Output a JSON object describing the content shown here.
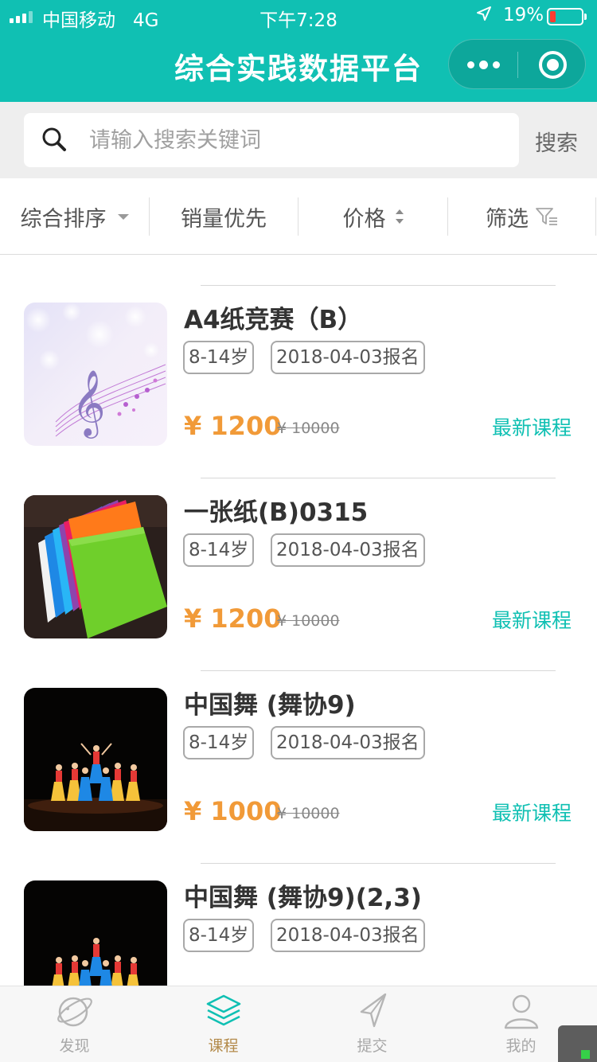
{
  "status_bar": {
    "carrier": "中国移动",
    "network": "4G",
    "time": "下午7:28",
    "battery_percent": "19%",
    "battery_level": 0.19
  },
  "nav": {
    "title": "综合实践数据平台",
    "more_icon": "more-dots-icon",
    "close_icon": "target-close-icon"
  },
  "search": {
    "placeholder": "请输入搜索关键词",
    "value": "",
    "button_label": "搜索"
  },
  "filters": [
    {
      "label": "综合排序",
      "icon": "caret-down-icon"
    },
    {
      "label": "销量优先"
    },
    {
      "label": "价格",
      "icon": "sort-updown-icon"
    },
    {
      "label": "筛选",
      "icon": "funnel-icon"
    }
  ],
  "courses": [
    {
      "title": "A4纸竞赛（B）",
      "age": "8-14岁",
      "enroll": "2018-04-03报名",
      "price": "¥ 1200",
      "original_price": "¥ 10000",
      "badge": "最新课程",
      "image": "music-notes-image"
    },
    {
      "title": "一张纸(B)0315",
      "age": "8-14岁",
      "enroll": "2018-04-03报名",
      "price": "¥ 1200",
      "original_price": "¥ 10000",
      "badge": "最新课程",
      "image": "colored-paper-image"
    },
    {
      "title": "中国舞 (舞协9)",
      "age": "8-14岁",
      "enroll": "2018-04-03报名",
      "price": "¥ 1000",
      "original_price": "¥ 10000",
      "badge": "最新课程",
      "image": "dance-stage-image"
    },
    {
      "title": "中国舞 (舞协9)(2,3)",
      "age": "8-14岁",
      "enroll": "2018-04-03报名",
      "price": "",
      "original_price": "",
      "badge": "",
      "image": "dance-stage-image"
    }
  ],
  "tabbar": [
    {
      "label": "发现",
      "icon": "planet-icon",
      "active": false
    },
    {
      "label": "课程",
      "icon": "layers-icon",
      "active": true
    },
    {
      "label": "提交",
      "icon": "paper-plane-icon",
      "active": false
    },
    {
      "label": "我的",
      "icon": "user-icon",
      "active": false
    }
  ],
  "colors": {
    "brand": "#10c0b3",
    "price": "#f19a38",
    "tab_active": "#b38a4a"
  }
}
